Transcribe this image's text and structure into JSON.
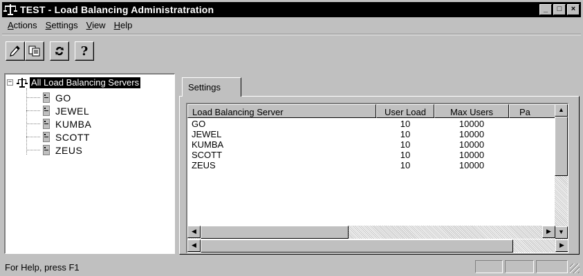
{
  "window": {
    "title": "TEST - Load Balancing Administratration",
    "minimize_glyph": "_",
    "maximize_glyph": "□",
    "close_glyph": "×"
  },
  "menu": [
    {
      "label": "Actions",
      "mnemonic": "A",
      "rest": "ctions"
    },
    {
      "label": "Settings",
      "mnemonic": "S",
      "rest": "ettings"
    },
    {
      "label": "View",
      "mnemonic": "V",
      "rest": "iew"
    },
    {
      "label": "Help",
      "mnemonic": "H",
      "rest": "elp"
    }
  ],
  "toolbar": {
    "icons": [
      "pencil-icon",
      "copy-icon",
      "refresh-icon",
      "help-icon"
    ],
    "help_glyph": "?"
  },
  "tree": {
    "expander": "−",
    "root_label": "All Load Balancing Servers",
    "items": [
      "GO",
      "JEWEL",
      "KUMBA",
      "SCOTT",
      "ZEUS"
    ]
  },
  "tabs": [
    {
      "label": "Settings"
    }
  ],
  "list": {
    "columns": [
      "Load Balancing Server",
      "User Load",
      "Max Users",
      "Pa"
    ],
    "rows": [
      [
        "GO",
        "10",
        "10000"
      ],
      [
        "JEWEL",
        "10",
        "10000"
      ],
      [
        "KUMBA",
        "10",
        "10000"
      ],
      [
        "SCOTT",
        "10",
        "10000"
      ],
      [
        "ZEUS",
        "10",
        "10000"
      ]
    ]
  },
  "status": {
    "text": "For Help, press F1"
  }
}
